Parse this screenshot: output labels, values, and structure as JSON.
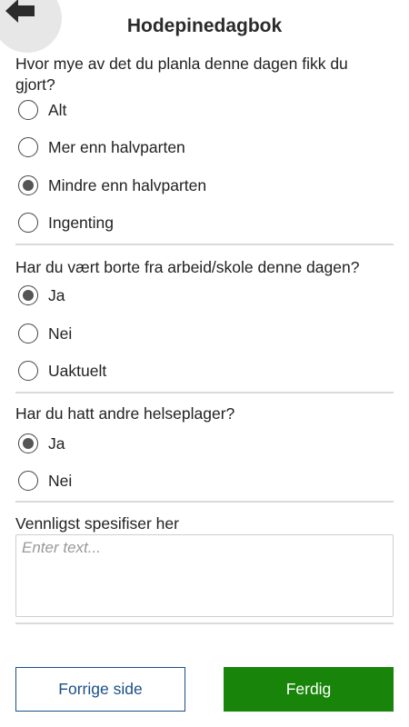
{
  "header": {
    "title": "Hodepinedagbok",
    "back_icon": "arrow-left-icon"
  },
  "q1": {
    "text": "Hvor mye av det du planla denne dagen fikk du gjort?",
    "options": [
      {
        "label": "Alt",
        "checked": false
      },
      {
        "label": "Mer enn halvparten",
        "checked": false
      },
      {
        "label": "Mindre enn halvparten",
        "checked": true
      },
      {
        "label": "Ingenting",
        "checked": false
      }
    ]
  },
  "q2": {
    "text": "Har du vært borte fra arbeid/skole denne dagen?",
    "options": [
      {
        "label": "Ja",
        "checked": true
      },
      {
        "label": "Nei",
        "checked": false
      },
      {
        "label": "Uaktuelt",
        "checked": false
      }
    ]
  },
  "q3": {
    "text": "Har du hatt andre helseplager?",
    "options": [
      {
        "label": "Ja",
        "checked": true
      },
      {
        "label": "Nei",
        "checked": false
      }
    ]
  },
  "specify": {
    "label": "Vennligst spesifiser her",
    "value": "",
    "placeholder": "Enter text..."
  },
  "buttons": {
    "prev_label": "Forrige side",
    "done_label": "Ferdig"
  },
  "colors": {
    "prev_border": "#1b4f87",
    "done_bg": "#18850a",
    "back_circle": "#e7e7e7"
  }
}
